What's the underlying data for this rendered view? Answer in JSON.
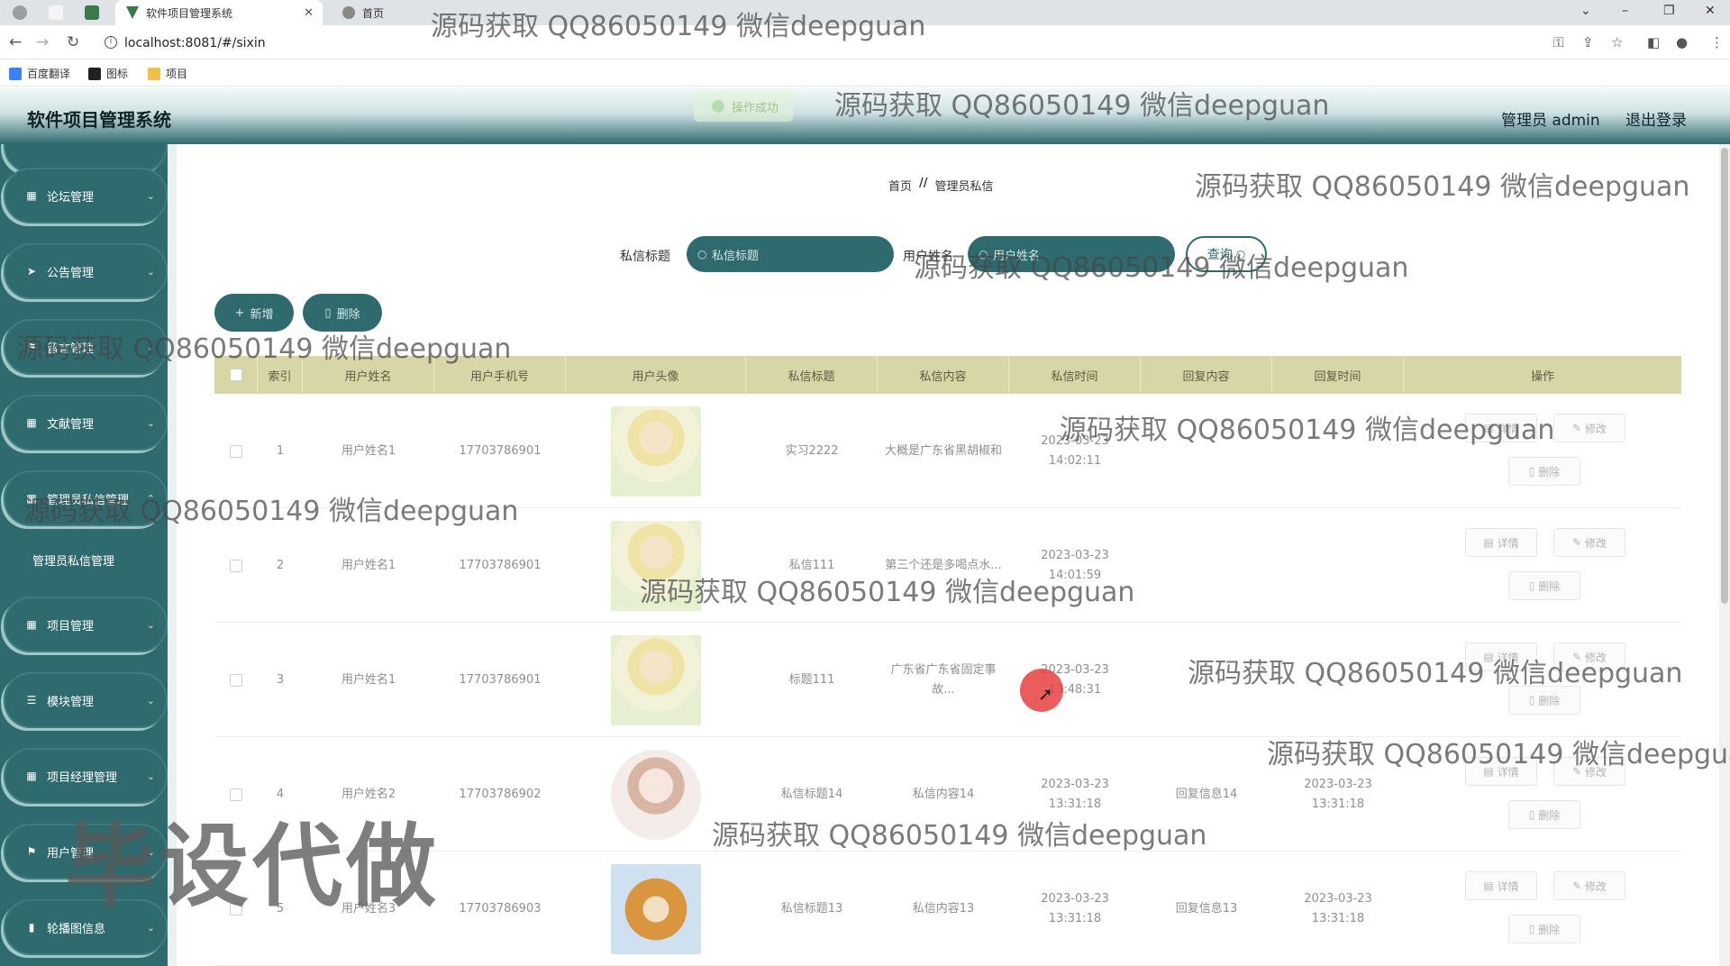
{
  "browser": {
    "active_tab_title": "软件项目管理系统",
    "second_tab_title": "首页",
    "url": "localhost:8081/#/sixin",
    "bookmarks": [
      "百度翻译",
      "图标",
      "项目"
    ]
  },
  "header": {
    "app_title": "软件项目管理系统",
    "user_label": "管理员 admin",
    "logout_label": "退出登录",
    "toast_text": "操作成功"
  },
  "sidebar": {
    "items": [
      {
        "label": "论坛管理"
      },
      {
        "label": "公告管理"
      },
      {
        "label": "留言管理"
      },
      {
        "label": "文献管理"
      },
      {
        "label": "管理员私信管理"
      },
      {
        "label": "管理员私信管理"
      },
      {
        "label": "项目管理"
      },
      {
        "label": "模块管理"
      },
      {
        "label": "项目经理管理"
      },
      {
        "label": "用户管理"
      },
      {
        "label": "轮播图信息"
      }
    ]
  },
  "breadcrumb": {
    "home": "首页",
    "separator": "//",
    "current": "管理员私信"
  },
  "search": {
    "title_label": "私信标题",
    "title_placeholder": "私信标题",
    "name_label": "用户姓名",
    "name_placeholder": "用户姓名",
    "query_label": "查询"
  },
  "actions": {
    "add_label": "新增",
    "delete_label": "删除"
  },
  "table": {
    "headers": [
      "索引",
      "用户姓名",
      "用户手机号",
      "用户头像",
      "私信标题",
      "私信内容",
      "私信时间",
      "回复内容",
      "回复时间",
      "操作"
    ],
    "rows": [
      {
        "index": "1",
        "name": "用户姓名1",
        "phone": "17703786901",
        "title": "实习2222",
        "content": "大概是广东省黑胡椒和",
        "time": "2023-03-23 14:02:11",
        "reply": "",
        "reply_time": ""
      },
      {
        "index": "2",
        "name": "用户姓名1",
        "phone": "17703786901",
        "title": "私信111",
        "content": "第三个还是多喝点水...",
        "time": "2023-03-23 14:01:59",
        "reply": "",
        "reply_time": ""
      },
      {
        "index": "3",
        "name": "用户姓名1",
        "phone": "17703786901",
        "title": "标题111",
        "content": "广东省广东省固定事故...",
        "time": "2023-03-23 13:48:31",
        "reply": "",
        "reply_time": ""
      },
      {
        "index": "4",
        "name": "用户姓名2",
        "phone": "17703786902",
        "title": "私信标题14",
        "content": "私信内容14",
        "time": "2023-03-23 13:31:18",
        "reply": "回复信息14",
        "reply_time": "2023-03-23 13:31:18"
      },
      {
        "index": "5",
        "name": "用户姓名3",
        "phone": "17703786903",
        "title": "私信标题13",
        "content": "私信内容13",
        "time": "2023-03-23 13:31:18",
        "reply": "回复信息13",
        "reply_time": "2023-03-23 13:31:18"
      }
    ],
    "op_detail": "详情",
    "op_edit": "修改",
    "op_delete": "删除"
  },
  "watermarks": {
    "text": "源码获取 QQ86050149 微信deepguan",
    "big_text": "毕设代做"
  },
  "colors": {
    "primary": "#2e6a6e",
    "table_header": "#d8d6a7",
    "accent_light": "#9fc6c8"
  }
}
